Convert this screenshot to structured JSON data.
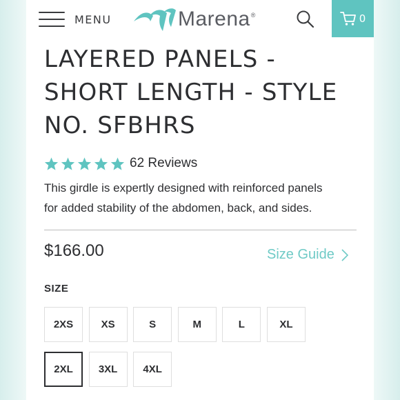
{
  "header": {
    "menu_label": "MENU",
    "logo_text": "Marena",
    "logo_reg": "®",
    "cart_count": "0",
    "accent_color": "#5fc4c0"
  },
  "product": {
    "title_lines": [
      "LAYERED PANELS -",
      "SHORT LENGTH - STYLE",
      "NO. SFBHRS"
    ],
    "rating_stars": 5,
    "rating_max": 5,
    "reviews_label": "62 Reviews",
    "description_lines": [
      "This girdle is expertly designed with reinforced panels",
      "for added stability of the abdomen, back, and sides."
    ],
    "price": "$166.00",
    "size_guide_label": "Size Guide",
    "size_heading": "SIZE",
    "sizes": [
      "2XS",
      "XS",
      "S",
      "M",
      "L",
      "XL",
      "2XL",
      "3XL",
      "4XL"
    ],
    "selected_size": "2XL"
  },
  "icons": {
    "menu": "hamburger-icon",
    "search": "search-icon",
    "cart": "cart-icon",
    "star": "star-icon",
    "chevron": "chevron-right-icon"
  }
}
